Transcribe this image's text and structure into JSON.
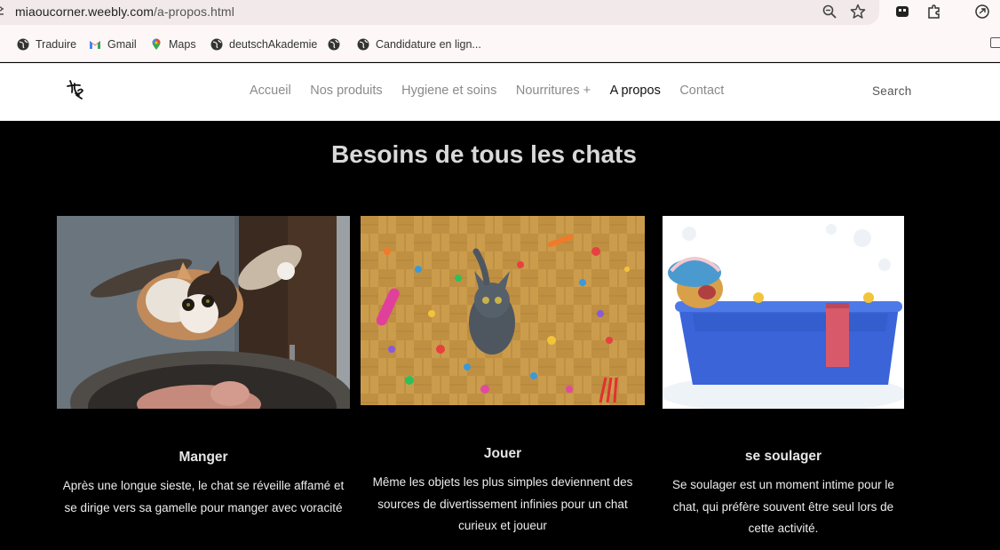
{
  "browser": {
    "url_domain": "miaoucorner.weebly.com",
    "url_path": "/a-propos.html",
    "icons": [
      "tune-icon",
      "zoom-icon",
      "star-icon",
      "extension-tile-icon",
      "puzzle-icon",
      "refresh-circle-icon"
    ]
  },
  "bookmarks": [
    {
      "label": "Traduire",
      "icon": "globe-icon"
    },
    {
      "label": "Gmail",
      "icon": "gmail-icon"
    },
    {
      "label": "Maps",
      "icon": "maps-pin-icon"
    },
    {
      "label": "deutschAkademie",
      "icon": "globe-icon"
    },
    {
      "label": "",
      "icon": "globe-icon"
    },
    {
      "label": "Candidature en lign...",
      "icon": "globe-icon"
    }
  ],
  "site": {
    "nav": [
      "Accueil",
      "Nos produits",
      "Hygiene et soins",
      "Nourritures +",
      "A propos",
      "Contact"
    ],
    "active_nav": "A propos",
    "search_label": "Search"
  },
  "page": {
    "heading": "Besoins de tous les chats",
    "cards": [
      {
        "title": "Manger",
        "text": "Après une longue sieste, le chat se réveille affamé et se dirige vers sa gamelle pour manger avec voracité",
        "image": "cat-eating-from-bowl"
      },
      {
        "title": "Jouer",
        "text": "Même les objets les plus simples deviennent des sources de divertissement infinies pour un chat curieux et joueur",
        "image": "cat-among-toys"
      },
      {
        "title": "se soulager",
        "text": "Se soulager est un moment intime pour le chat, qui préfère souvent être seul lors de cette activité.",
        "image": "cat-in-bathtub"
      }
    ]
  },
  "colors": {
    "page_bg": "#000000",
    "header_bg": "#ffffff",
    "nav_text": "#8a8a8a",
    "nav_active": "#111111",
    "heading_text": "#d9d9d9"
  }
}
